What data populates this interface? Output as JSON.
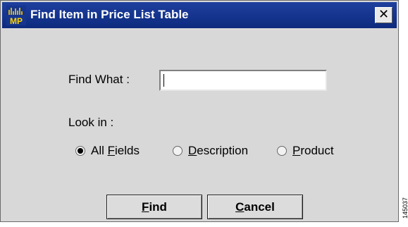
{
  "window": {
    "title": "Find Item in Price List Table",
    "app_icon_label": "MP",
    "close_glyph": "✕"
  },
  "form": {
    "find_what_label": "Find What :",
    "find_what_value": "",
    "look_in_label": "Look in :",
    "options": [
      {
        "label_prefix": "All ",
        "label_mnemonic": "F",
        "label_rest": "ields",
        "checked": true
      },
      {
        "label_prefix": "",
        "label_mnemonic": "D",
        "label_rest": "escription",
        "checked": false
      },
      {
        "label_prefix": "",
        "label_mnemonic": "P",
        "label_rest": "roduct",
        "checked": false
      }
    ]
  },
  "buttons": {
    "find_mnemonic": "F",
    "find_rest": "ind",
    "cancel_mnemonic": "C",
    "cancel_rest": "ancel"
  },
  "figure_id": "145037",
  "colors": {
    "titlebar": "#15358f",
    "background": "#d8d8d8"
  }
}
